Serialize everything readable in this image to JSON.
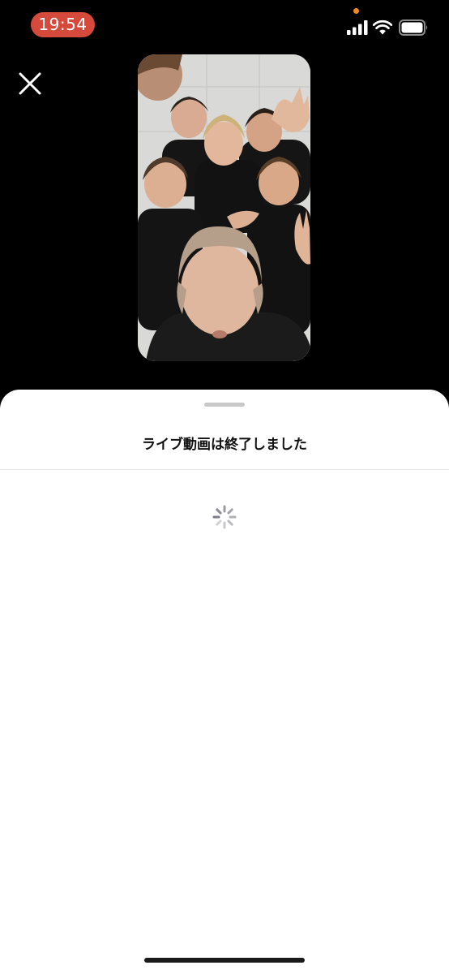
{
  "status_bar": {
    "time": "19:54",
    "icons": [
      "cellular-signal-icon",
      "wifi-icon",
      "battery-icon"
    ],
    "time_pill_color": "#d64a3c",
    "privacy_dot_color": "#f08a24"
  },
  "header": {
    "close_icon": "close-icon"
  },
  "video": {
    "thumbnail": "live-video-thumbnail"
  },
  "sheet": {
    "title": "ライブ動画は終了しました",
    "loading_icon": "loading-spinner-icon"
  }
}
